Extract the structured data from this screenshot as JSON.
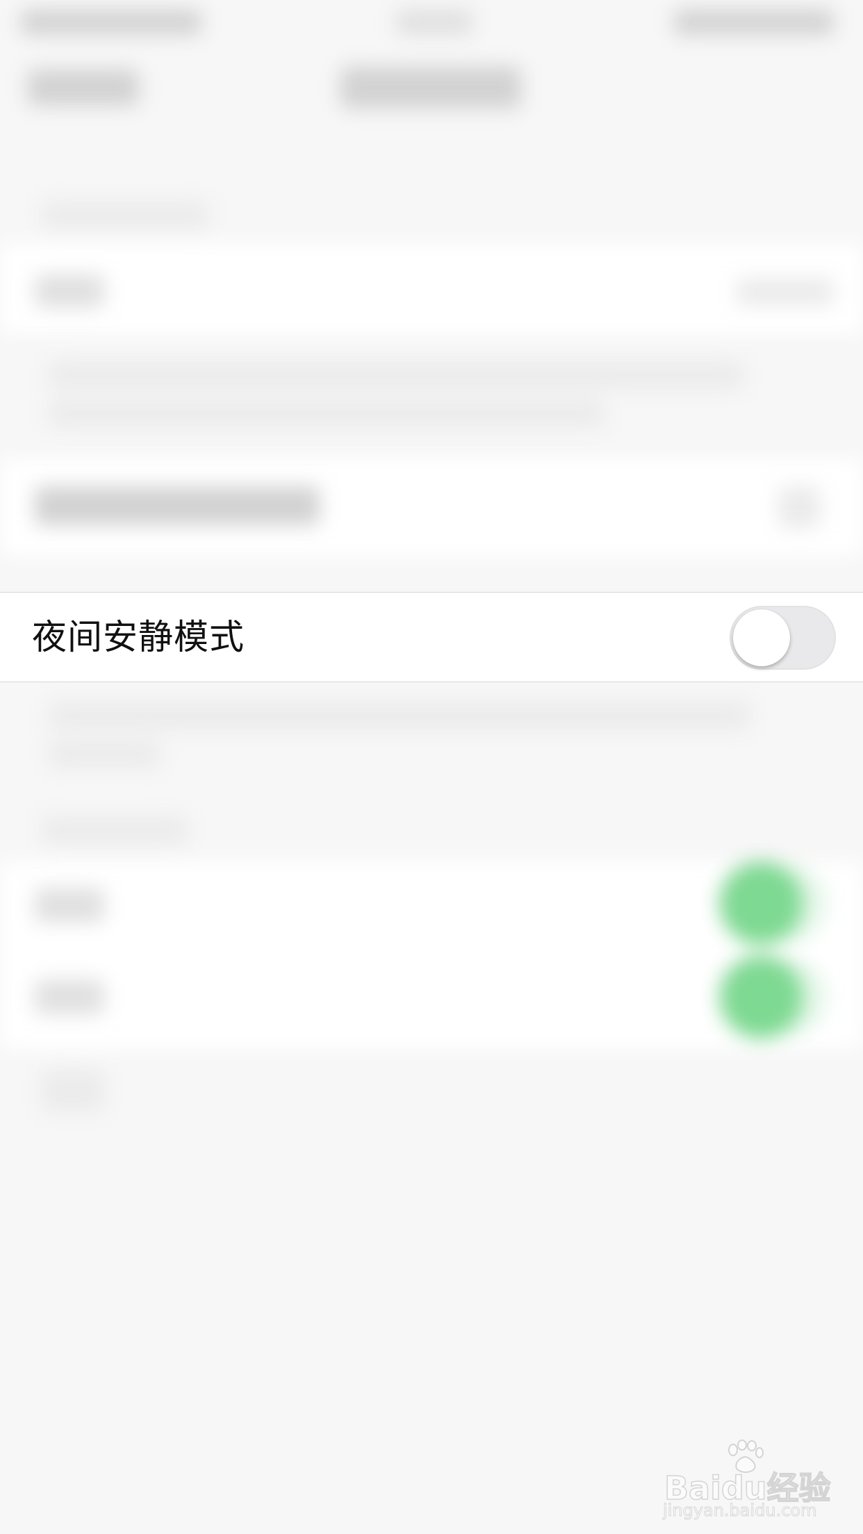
{
  "settings_row": {
    "label": "夜间安静模式",
    "toggle_on": false
  },
  "watermark": {
    "brand": "Baidu经验",
    "url": "jingyan.baidu.com"
  },
  "colors": {
    "background": "#f7f7f7",
    "cell_background": "#ffffff",
    "separator": "#d6d6d6",
    "toggle_off_track": "#e9e9eb",
    "toggle_on_track": "#7ed992",
    "label_text": "#111111"
  }
}
